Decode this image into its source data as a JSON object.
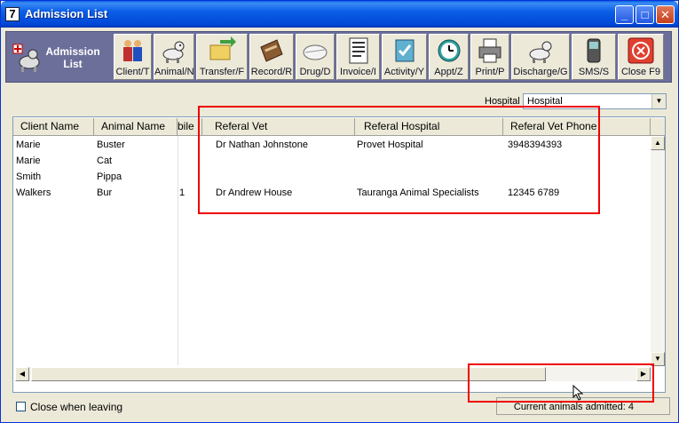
{
  "window": {
    "app_icon": "7",
    "title": "Admission List"
  },
  "toolbar": {
    "logo_label_line1": "Admission",
    "logo_label_line2": "List",
    "buttons": [
      {
        "label": "Client/T",
        "icon": "clients-icon"
      },
      {
        "label": "Animal/N",
        "icon": "dog-icon"
      },
      {
        "label": "Transfer/F",
        "icon": "transfer-icon"
      },
      {
        "label": "Record/R",
        "icon": "record-icon"
      },
      {
        "label": "Drug/D",
        "icon": "drug-icon"
      },
      {
        "label": "Invoice/I",
        "icon": "invoice-icon"
      },
      {
        "label": "Activity/Y",
        "icon": "activity-icon"
      },
      {
        "label": "Appt/Z",
        "icon": "clock-icon"
      },
      {
        "label": "Print/P",
        "icon": "printer-icon"
      },
      {
        "label": "Discharge/G",
        "icon": "discharge-icon"
      },
      {
        "label": "SMS/S",
        "icon": "phone-icon"
      },
      {
        "label": "Close F9",
        "icon": "close-icon"
      }
    ]
  },
  "filter": {
    "hospital_label": "Hospital",
    "hospital_value": "Hospital"
  },
  "grid": {
    "columns": [
      "Client Name",
      "Animal Name",
      "bile",
      "Referal Vet",
      "Referal Hospital",
      "Referal Vet Phone"
    ],
    "rows": [
      [
        "Marie",
        "Buster",
        "",
        "Dr Nathan Johnstone",
        "Provet Hospital",
        "3948394393"
      ],
      [
        "Marie",
        "Cat",
        "",
        "",
        "",
        ""
      ],
      [
        "Smith",
        "Pippa",
        "",
        "",
        "",
        ""
      ],
      [
        "Walkers",
        "Bur",
        "1",
        "Dr Andrew House",
        "Tauranga Animal Specialists",
        "12345 6789"
      ]
    ]
  },
  "footer": {
    "close_when_leaving_label": "Close when leaving",
    "close_when_leaving_checked": false,
    "status": "Current animals admitted: 4"
  },
  "colors": {
    "toolbar_bg": "#6b6f9a",
    "highlight_box": "#e00000"
  }
}
